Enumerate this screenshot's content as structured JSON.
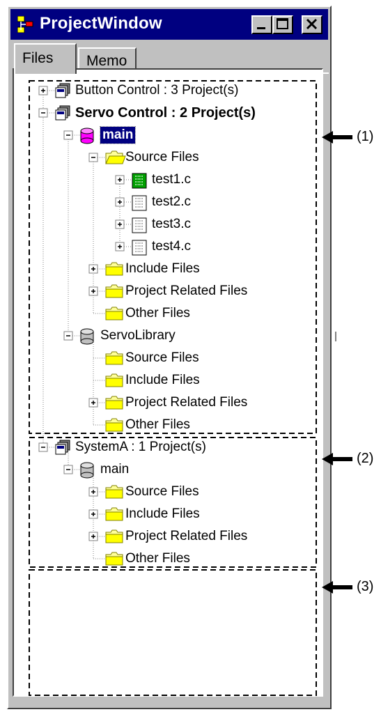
{
  "window": {
    "title": "ProjectWindow",
    "title_color": "#000080"
  },
  "tabs": [
    {
      "label": "Files",
      "active": true
    },
    {
      "label": "Memo",
      "active": false
    }
  ],
  "tree": {
    "nodes": [
      {
        "label": "Button Control : 3 Project(s)",
        "icon": "workspace-icon",
        "expander": "plus"
      },
      {
        "label": "Servo Control : 2 Project(s)",
        "icon": "workspace-icon",
        "expander": "minus",
        "bold": true
      },
      {
        "label": "main",
        "icon": "project-db-icon-magenta",
        "expander": "minus",
        "selected": true
      },
      {
        "label": "Source Files",
        "icon": "open-folder-icon",
        "expander": "minus"
      },
      {
        "label": "test1.c",
        "icon": "c-file-opt-icon",
        "expander": "plus"
      },
      {
        "label": "test2.c",
        "icon": "c-file-icon",
        "expander": "plus"
      },
      {
        "label": "test3.c",
        "icon": "c-file-icon",
        "expander": "plus"
      },
      {
        "label": "test4.c",
        "icon": "c-file-icon",
        "expander": "plus"
      },
      {
        "label": "Include Files",
        "icon": "folder-icon",
        "expander": "plus"
      },
      {
        "label": "Project Related Files",
        "icon": "folder-icon",
        "expander": "plus"
      },
      {
        "label": "Other Files",
        "icon": "folder-icon",
        "expander": "none"
      },
      {
        "label": "ServoLibrary",
        "icon": "project-db-icon",
        "expander": "minus"
      },
      {
        "label": "Source Files",
        "icon": "folder-icon",
        "expander": "none"
      },
      {
        "label": "Include Files",
        "icon": "folder-icon",
        "expander": "none"
      },
      {
        "label": "Project Related Files",
        "icon": "folder-icon",
        "expander": "plus"
      },
      {
        "label": "Other Files",
        "icon": "folder-icon",
        "expander": "none"
      },
      {
        "label": "SystemA : 1 Project(s)",
        "icon": "workspace-icon",
        "expander": "minus"
      },
      {
        "label": "main",
        "icon": "project-db-icon",
        "expander": "minus"
      },
      {
        "label": "Source Files",
        "icon": "folder-icon",
        "expander": "plus"
      },
      {
        "label": "Include Files",
        "icon": "folder-icon",
        "expander": "plus"
      },
      {
        "label": "Project Related Files",
        "icon": "folder-icon",
        "expander": "plus"
      },
      {
        "label": "Other Files",
        "icon": "folder-icon",
        "expander": "none"
      }
    ]
  },
  "callouts": [
    {
      "label": "(1)"
    },
    {
      "label": "(2)"
    },
    {
      "label": "(3)"
    }
  ]
}
